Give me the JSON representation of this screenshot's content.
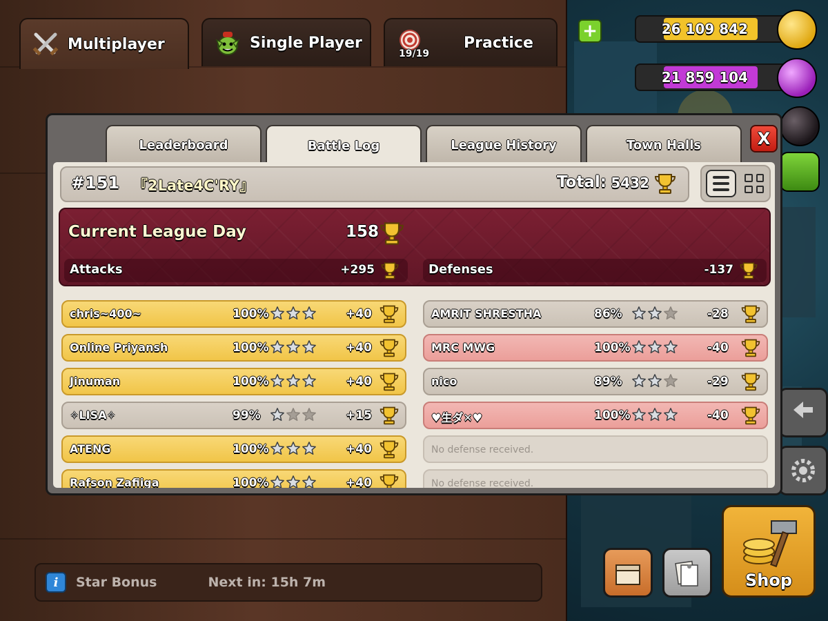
{
  "top_tabs": {
    "multiplayer": "Multiplayer",
    "single_player": "Single Player",
    "practice": "Practice",
    "practice_counter": "19/19"
  },
  "resources": {
    "gold": "26 109 842",
    "elixir": "21 859 104",
    "gold_color": "#f2c32a",
    "elixir_color": "#c23ad6"
  },
  "modal": {
    "tabs": [
      "Leaderboard",
      "Battle Log",
      "League History",
      "Town Halls"
    ],
    "active_tab": "Battle Log",
    "close_label": "X"
  },
  "player": {
    "rank": "#151",
    "name": "『2Late4C'RY』",
    "total_label": "Total:",
    "total_value": "5432"
  },
  "league_day": {
    "title": "Current League Day",
    "value": "158",
    "attacks_label": "Attacks",
    "attacks_value": "+295",
    "defenses_label": "Defenses",
    "defenses_value": "-137"
  },
  "attacks": [
    {
      "name": "chris~400~",
      "percent": "100%",
      "stars": 3,
      "trophies": "+40",
      "result": "win"
    },
    {
      "name": "Online   Priyansh",
      "percent": "100%",
      "stars": 3,
      "trophies": "+40",
      "result": "win"
    },
    {
      "name": "Jinuman",
      "percent": "100%",
      "stars": 3,
      "trophies": "+40",
      "result": "win"
    },
    {
      "name": "✧LISA✧",
      "percent": "99%",
      "stars": 1,
      "trophies": "+15",
      "result": "partial"
    },
    {
      "name": "ATENG",
      "percent": "100%",
      "stars": 3,
      "trophies": "+40",
      "result": "win"
    },
    {
      "name": "Rafson Zafiiga",
      "percent": "100%",
      "stars": 3,
      "trophies": "+40",
      "result": "win"
    }
  ],
  "defenses": [
    {
      "name": "AMRIT SHRESTHA",
      "percent": "86%",
      "stars": 2,
      "trophies": "-28",
      "result": "partial"
    },
    {
      "name": "MRC MWG",
      "percent": "100%",
      "stars": 3,
      "trophies": "-40",
      "result": "loss"
    },
    {
      "name": "nico",
      "percent": "89%",
      "stars": 2,
      "trophies": "-29",
      "result": "partial"
    },
    {
      "name": "♥生ダ✕♥",
      "percent": "100%",
      "stars": 3,
      "trophies": "-40",
      "result": "loss"
    },
    {
      "empty_text": "No defense received."
    },
    {
      "empty_text": "No defense received."
    }
  ],
  "footer": {
    "star_bonus": "Star Bonus",
    "next_in": "Next in: 15h 7m"
  },
  "shop": {
    "label": "Shop"
  }
}
